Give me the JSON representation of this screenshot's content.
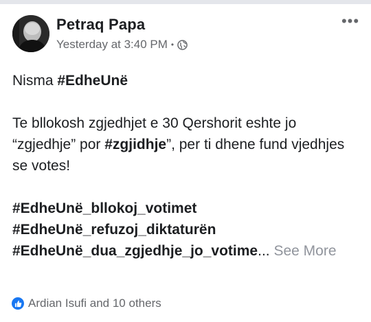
{
  "post": {
    "author": "Petraq Papa",
    "timestamp": "Yesterday at 3:40 PM",
    "separator": "•",
    "privacy_icon": "globe-icon",
    "more_icon": "more-horizontal-icon",
    "body": {
      "line1_prefix": "Nisma ",
      "line1_hashtag": "#EdheUnë",
      "para2_text_a": "Te bllokosh zgjedhjet e 30 Qershorit eshte jo “zgjedhje” por ",
      "para2_hashtag": "#zgjidhje",
      "para2_text_b": "”, per ti dhene fund vjedhjes se votes!",
      "hashtag1": "#EdheUnë_bllokoj_votimet",
      "hashtag2": "#EdheUnë_refuzoj_diktaturën",
      "hashtag3": "#EdheUnë_dua_zgjedhje_jo_votime",
      "ellipsis": "...",
      "see_more": "See More"
    },
    "reactions": {
      "icon": "like-icon",
      "text": "Ardian Isufi and 10 others"
    }
  },
  "colors": {
    "primary_text": "#1c1e21",
    "secondary_text": "#65676b",
    "see_more": "#90949c",
    "like_blue": "#1877f2"
  }
}
